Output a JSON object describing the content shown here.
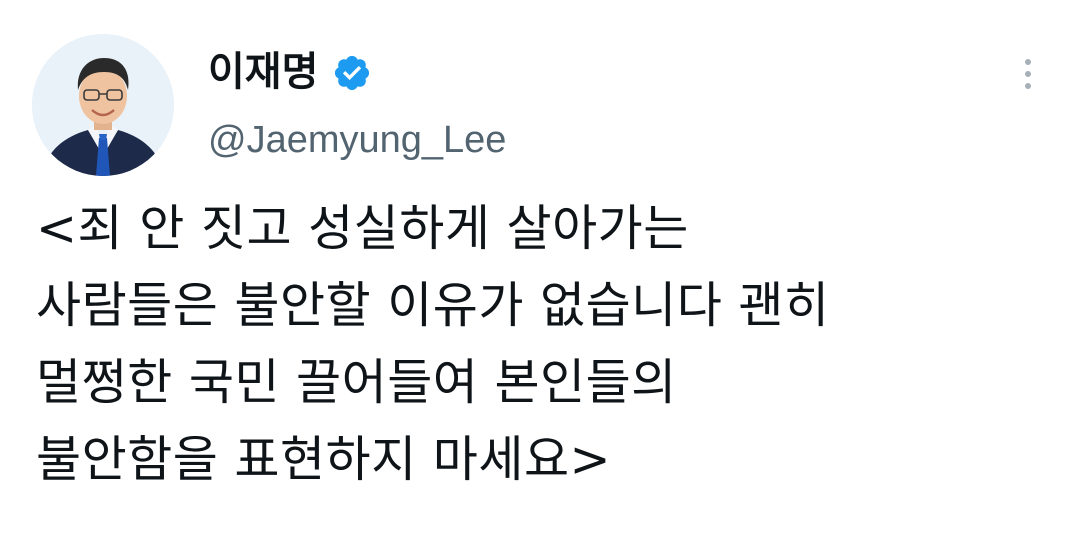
{
  "author": {
    "display_name": "이재명",
    "handle": "@Jaemyung_Lee",
    "verified": true,
    "verified_color": "#1d9bf0"
  },
  "tweet": {
    "lines": [
      "<죄 안 짓고 성실하게 살아가는",
      "사람들은 불안할 이유가 없습니다 괜히",
      "멀쩡한 국민 끌어들여 본인들의",
      "불안함을 표현하지 마세요>"
    ]
  },
  "icons": {
    "verified": "verified-badge-icon",
    "more": "more-options-icon",
    "avatar": "profile-avatar"
  },
  "colors": {
    "text": "#0f1419",
    "secondary": "#536471",
    "background": "#ffffff"
  }
}
